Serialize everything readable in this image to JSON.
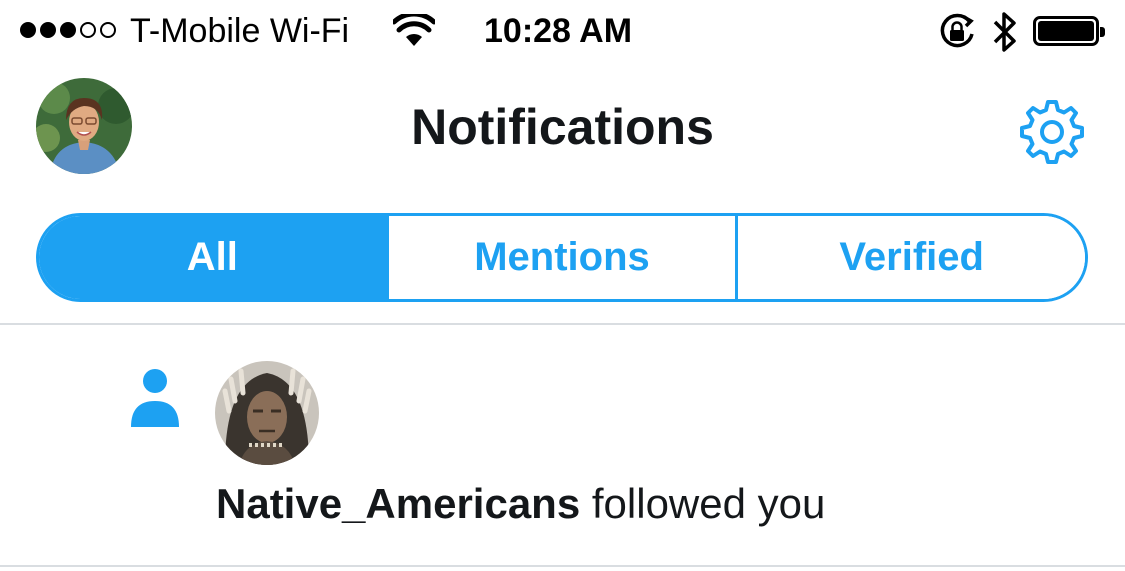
{
  "status_bar": {
    "carrier": "T-Mobile Wi-Fi",
    "time": "10:28 AM",
    "signal_bars_filled": 3,
    "signal_bars_total": 5
  },
  "header": {
    "title": "Notifications"
  },
  "tabs": [
    {
      "label": "All",
      "active": true
    },
    {
      "label": "Mentions",
      "active": false
    },
    {
      "label": "Verified",
      "active": false
    }
  ],
  "notifications": [
    {
      "icon": "person-follow-icon",
      "username": "Native_Americans",
      "action": "followed you"
    }
  ],
  "colors": {
    "accent": "#1da1f2",
    "text": "#14171a",
    "divider": "#d9dde1"
  }
}
